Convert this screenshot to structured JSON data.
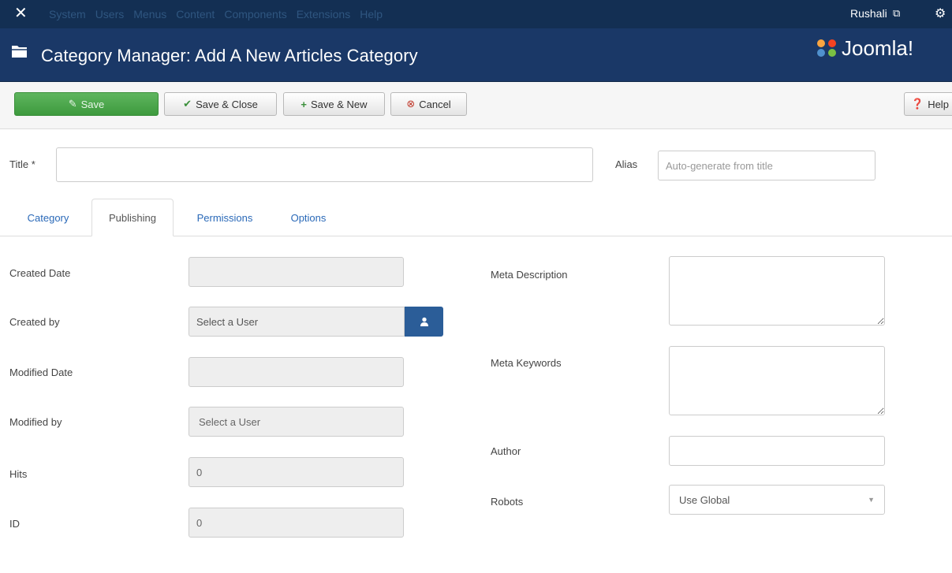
{
  "topbar": {
    "menu": [
      "System",
      "Users",
      "Menus",
      "Content",
      "Components",
      "Extensions",
      "Help"
    ],
    "user": "Rushali"
  },
  "header": {
    "title": "Category Manager: Add A New Articles Category",
    "brand": "Joomla!"
  },
  "toolbar": {
    "save": "Save",
    "save_close": "Save & Close",
    "save_new": "Save & New",
    "cancel": "Cancel",
    "help": "Help"
  },
  "form": {
    "title_label": "Title *",
    "title_value": "",
    "alias_label": "Alias",
    "alias_placeholder": "Auto-generate from title"
  },
  "tabs": [
    "Category",
    "Publishing",
    "Permissions",
    "Options"
  ],
  "active_tab": "Publishing",
  "publishing": {
    "created_date_label": "Created Date",
    "created_by_label": "Created by",
    "created_by_value": "Select a User",
    "modified_date_label": "Modified Date",
    "modified_by_label": "Modified by",
    "modified_by_value": "Select a User",
    "hits_label": "Hits",
    "hits_value": "0",
    "id_label": "ID",
    "id_value": "0",
    "meta_description_label": "Meta Description",
    "meta_keywords_label": "Meta Keywords",
    "author_label": "Author",
    "robots_label": "Robots",
    "robots_value": "Use Global"
  },
  "colors": {
    "topbar": "#132f53",
    "header": "#1a3867",
    "save_button": "#4caf50",
    "link": "#2a69b8",
    "user_button": "#2b5d98"
  }
}
